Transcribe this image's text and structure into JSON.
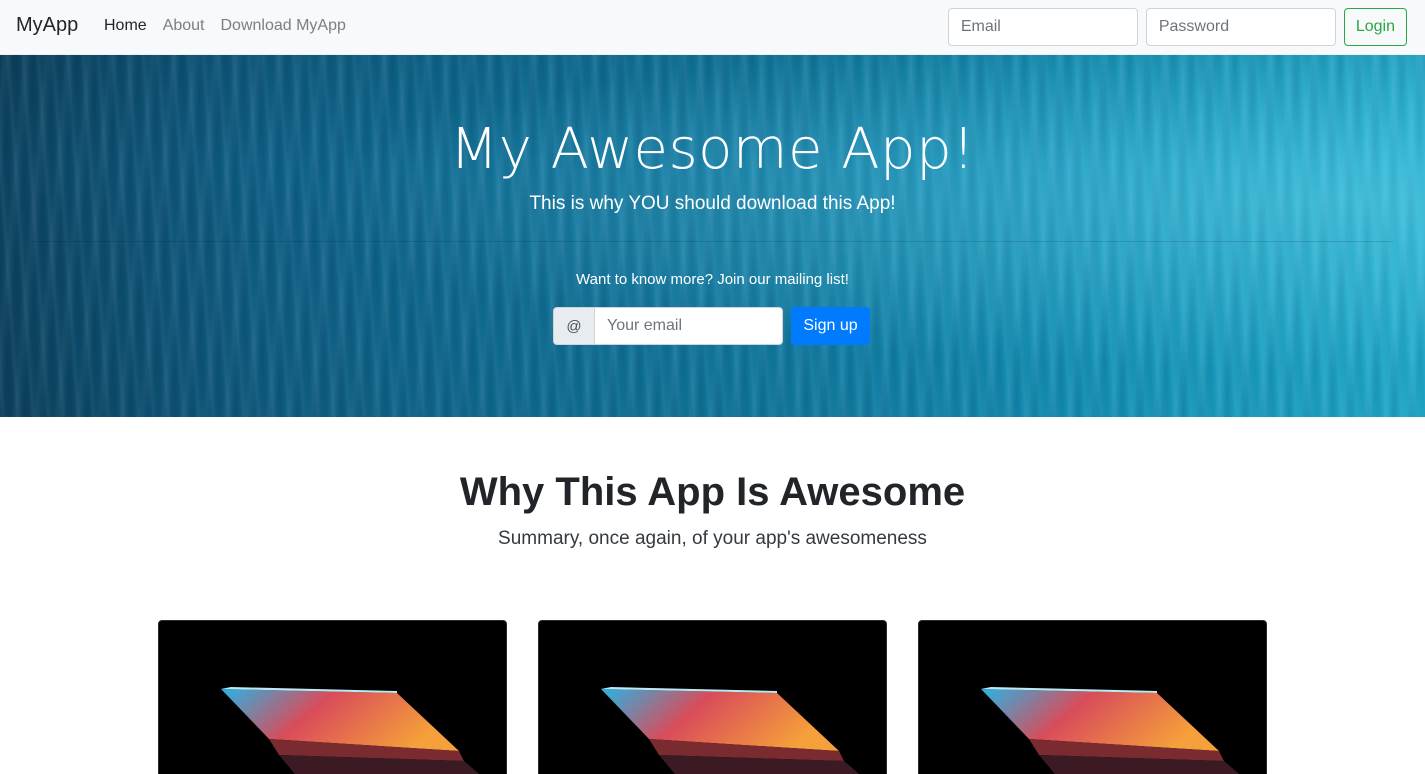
{
  "navbar": {
    "brand": "MyApp",
    "links": [
      {
        "label": "Home",
        "active": true
      },
      {
        "label": "About",
        "active": false
      },
      {
        "label": "Download MyApp",
        "active": false
      }
    ],
    "email_placeholder": "Email",
    "password_placeholder": "Password",
    "login_label": "Login"
  },
  "hero": {
    "title": "My Awesome App!",
    "subtitle": "This is why YOU should download this App!",
    "cta": "Want to know more? Join our mailing list!",
    "input_prefix": "@",
    "email_placeholder": "Your email",
    "signup_label": "Sign up"
  },
  "features": {
    "title": "Why This App Is Awesome",
    "subtitle": "Summary, once again, of your app's awesomeness"
  },
  "colors": {
    "navbar_bg": "#f8f9fa",
    "login_green": "#28a745",
    "signup_blue": "#007bff",
    "hero_teal": "#117ea6"
  }
}
